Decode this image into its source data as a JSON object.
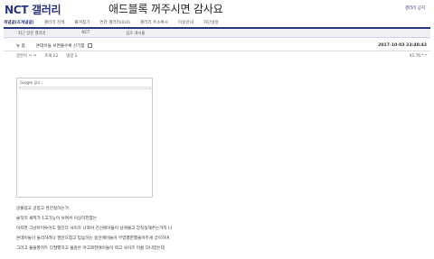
{
  "header": {
    "gallery_title": "NCT 갤러리",
    "banner_text": "애드블록 꺼주시면 감사요",
    "notice_link": "갤러리 공지"
  },
  "tabs": [
    {
      "label": "개념글(조개념글)",
      "active": true
    },
    {
      "label": "갤러리 검색",
      "active": false
    },
    {
      "label": "즐겨찾기",
      "active": false
    },
    {
      "label": "연관 갤러리(0/4)",
      "active": false
    },
    {
      "label": "갤러리 주소복사",
      "active": false
    },
    {
      "label": "이용안내",
      "active": false
    },
    {
      "label": "차단설정",
      "active": false
    }
  ],
  "subbar": {
    "recent": "최근 방문 갤러리",
    "nct": "NCT",
    "sports": "심즈 게시물"
  },
  "post": {
    "category": "뉴 봄",
    "title": "온데이들 보면볼수록 신기함 ",
    "date": "2017-10-03 23:48:43",
    "author": "글쓴이 ㅋ ㅋ",
    "views": "조회 22",
    "comments": "댓글 2",
    "ip": "45.76.*.*"
  },
  "ad": {
    "label": "Google 광고 ›"
  },
  "body": [
    "글볼링고 글봉고 완진실하는거",
    "솔직히 새끼가 1고가능이 보여서 이상하한함는",
    "이자한 그냥아이투어도 형진다 사이즈 나와야 진선애이들이 남쳐볼고 장직실해주는거지 나",
    "온데이들이 돌리하려나 팔안호참고 있음하는 동안애이들이 무었했한했을어주게 궁이히며",
    "그러고 불을봤지두 다팔했하고 물같은 아고와한애이들이 력고 사이즈 이름 다니었는데"
  ]
}
